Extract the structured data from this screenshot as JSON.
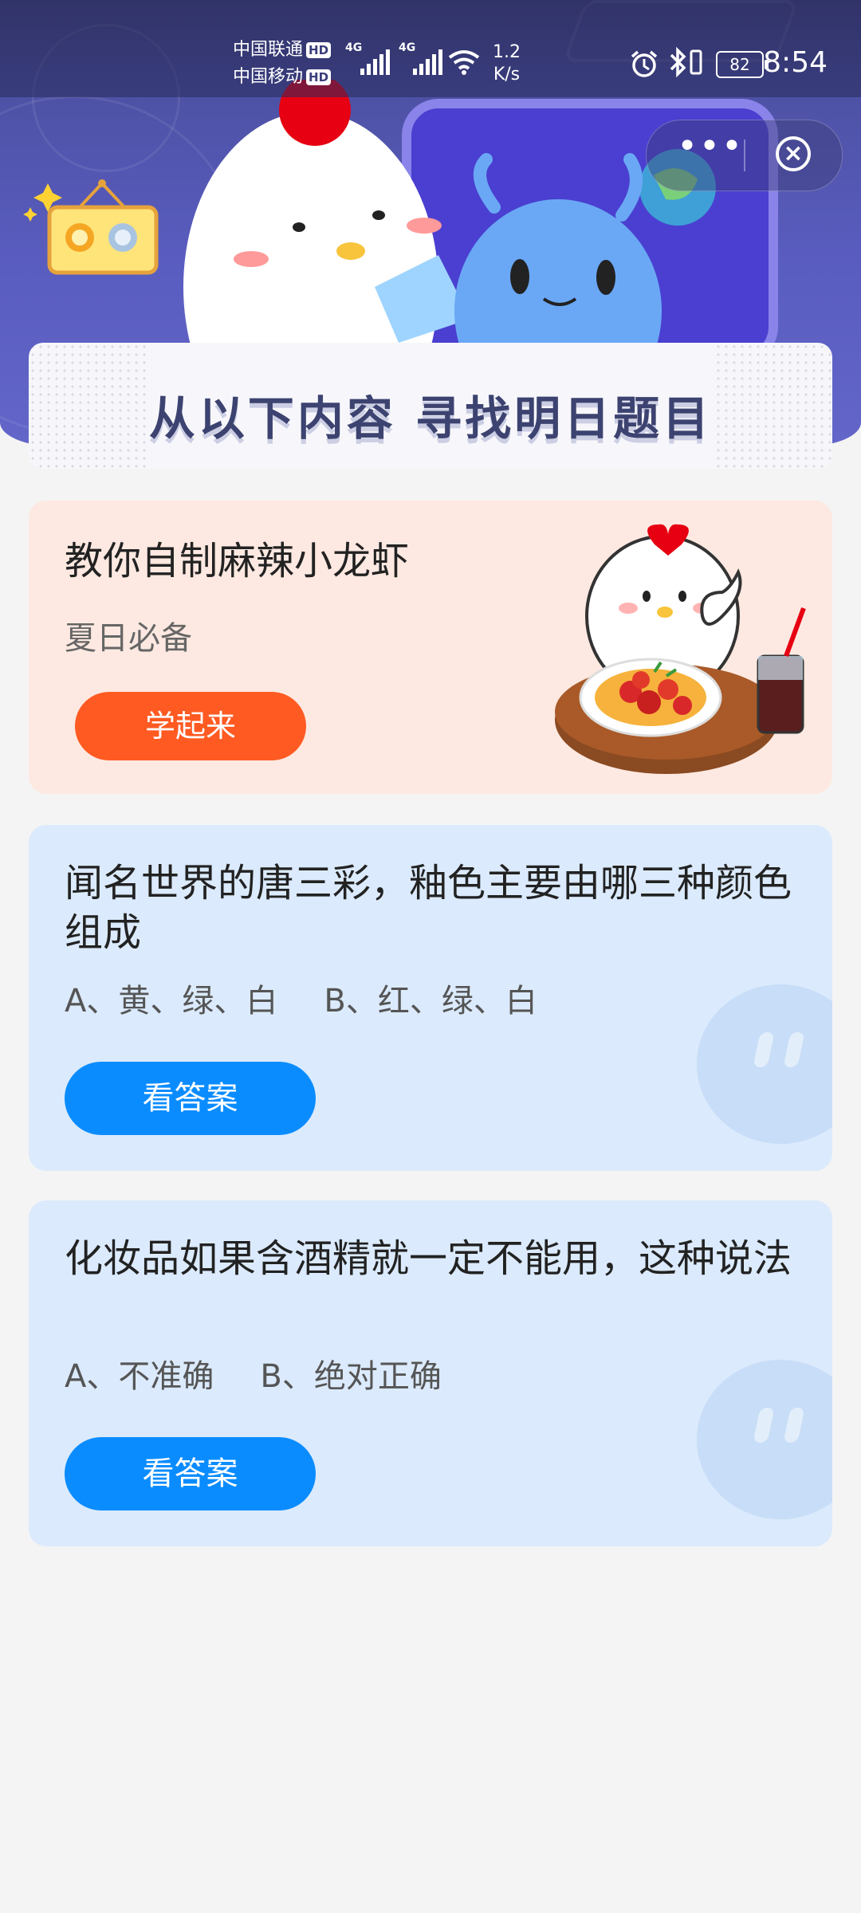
{
  "status_bar": {
    "carrier1": "中国联通",
    "carrier2": "中国移动",
    "hd": "HD",
    "signal_type": "4G",
    "net_speed_value": "1.2",
    "net_speed_unit": "K/s",
    "battery": "82",
    "time": "8:54"
  },
  "banner": {
    "title": "从以下内容  寻找明日题目"
  },
  "capsule": {
    "more_icon": "more-dots-icon",
    "close_icon": "close-circle-icon"
  },
  "cards": [
    {
      "title": "教你自制麻辣小龙虾",
      "subtitle": "夏日必备",
      "button": "学起来"
    },
    {
      "title": "闻名世界的唐三彩，釉色主要由哪三种颜色组成",
      "options": [
        "A、黄、绿、白",
        "B、红、绿、白"
      ],
      "button": "看答案"
    },
    {
      "title": "化妆品如果含酒精就一定不能用，这种说法",
      "options": [
        "A、不准确",
        "B、绝对正确"
      ],
      "button": "看答案"
    }
  ],
  "colors": {
    "header_bg": "#4d51a3",
    "orange_button": "#ff5a22",
    "blue_button": "#0a8cff",
    "card_pink": "#fde9e1",
    "card_blue": "#dbeafc"
  }
}
